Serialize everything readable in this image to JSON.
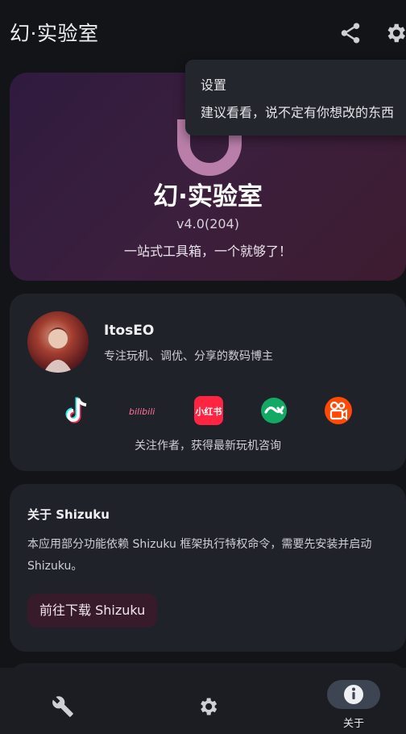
{
  "header": {
    "title": "幻·实验室",
    "icons": [
      "share-icon",
      "settings-icon"
    ]
  },
  "hero": {
    "name": "幻·实验室",
    "version": "v4.0(204)",
    "tagline": "一站式工具箱，一个就够了！"
  },
  "tooltip": {
    "title": "设置",
    "body": "建议看看，说不定有你想改的东西"
  },
  "author": {
    "name": "ItosEO",
    "description": "专注玩机、调优、分享的数码博主",
    "socials": [
      {
        "name": "douyin",
        "label": ""
      },
      {
        "name": "bilibili",
        "label": "bilibili"
      },
      {
        "name": "xiaohongshu",
        "label": "小红书"
      },
      {
        "name": "coolapk",
        "label": ""
      },
      {
        "name": "kuaishou",
        "label": ""
      }
    ],
    "follow_text": "关注作者，获得最新玩机咨询"
  },
  "shizuku": {
    "title": "关于 Shizuku",
    "description": "本应用部分功能依赖 Shizuku 框架执行特权命令，需要先安装并启动 Shizuku。",
    "button": "前往下载 Shizuku"
  },
  "bottom_nav": {
    "items": [
      {
        "icon": "wrench-icon",
        "label": ""
      },
      {
        "icon": "gear-icon",
        "label": ""
      },
      {
        "icon": "info-icon",
        "label": "关于",
        "selected": true
      }
    ]
  },
  "colors": {
    "background": "#121418",
    "card": "#1f2228",
    "accent_pill": "#3e4552",
    "button": "#371b2b"
  }
}
